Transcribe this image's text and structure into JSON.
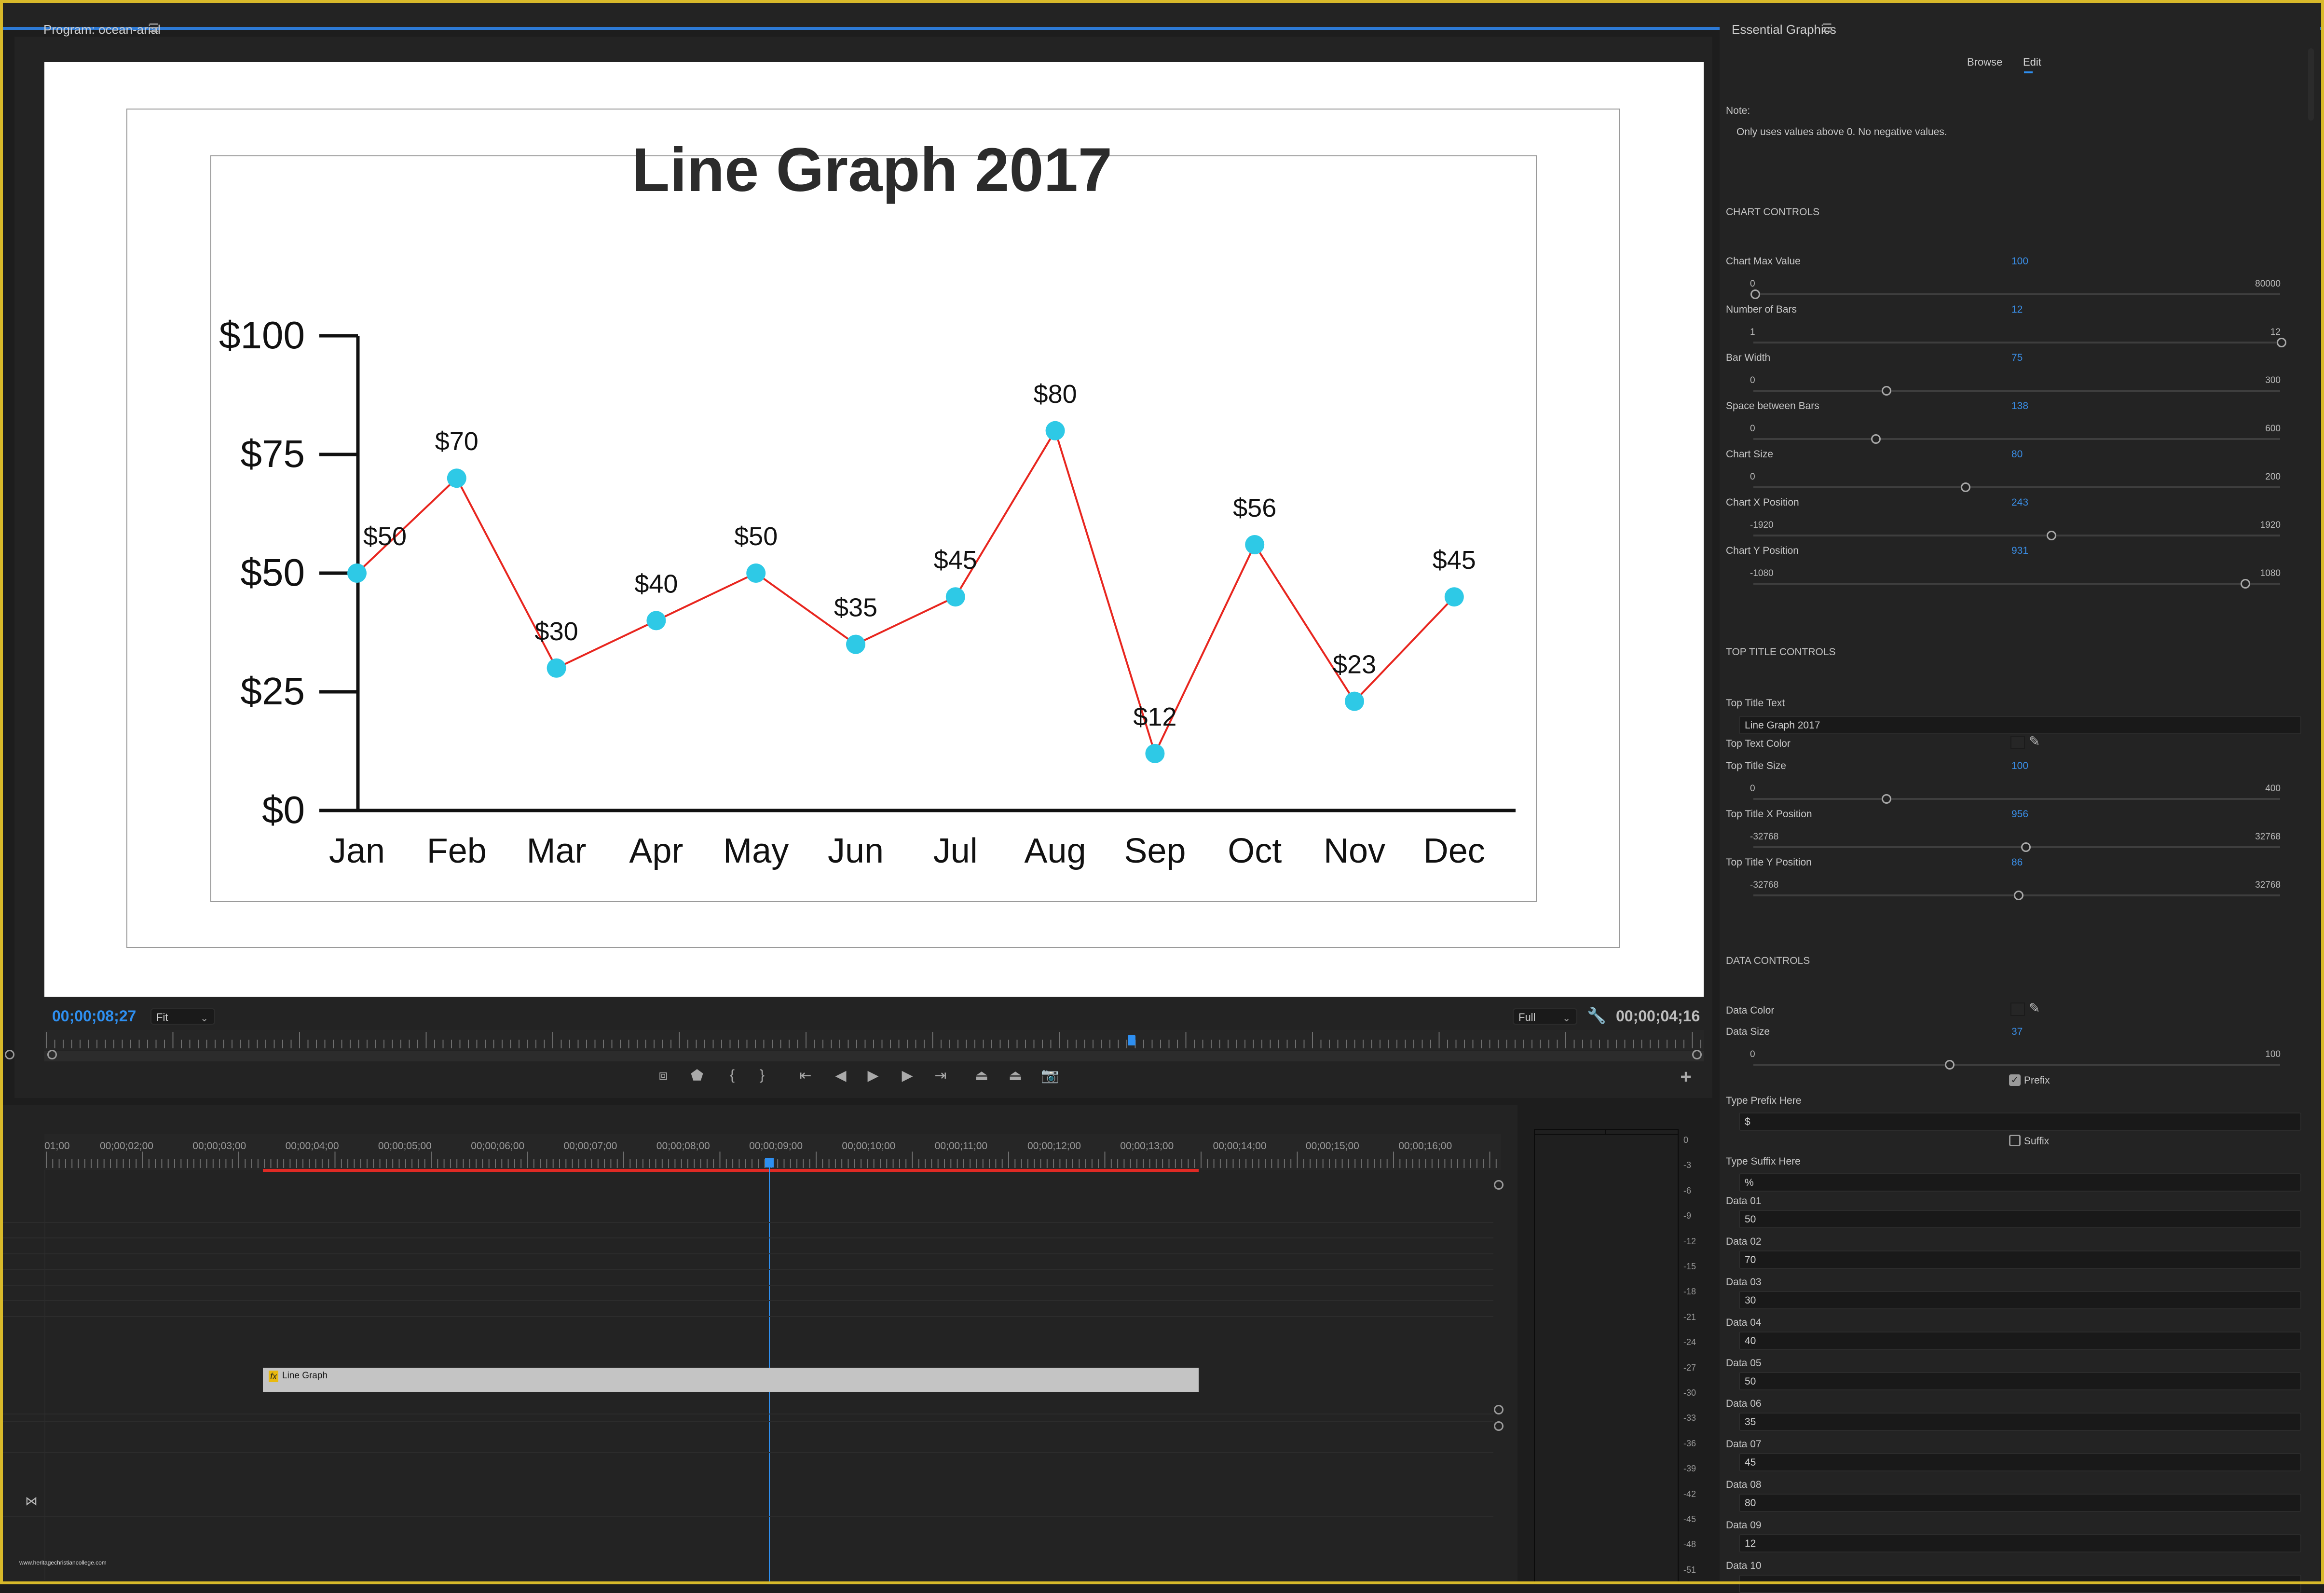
{
  "program_panel": {
    "title": "Program: ocean-arial",
    "menu_icon": "hamburger-menu-icon",
    "current_timecode": "00;00;08;27",
    "zoom_select": "Fit",
    "resolution_select": "Full",
    "duration_timecode": "00;00;04;16",
    "transport_icons": [
      "safe-margins-icon",
      "add-marker-icon",
      "mark-in-icon",
      "mark-out-icon",
      "go-to-in-icon",
      "step-back-icon",
      "play-icon",
      "step-forward-icon",
      "go-to-out-icon",
      "lift-icon",
      "extract-icon",
      "export-frame-icon"
    ],
    "add_button": "+"
  },
  "chart_data": {
    "type": "line",
    "title": "Line Graph 2017",
    "categories": [
      "Jan",
      "Feb",
      "Mar",
      "Apr",
      "May",
      "Jun",
      "Jul",
      "Aug",
      "Sep",
      "Oct",
      "Nov",
      "Dec"
    ],
    "series": [
      {
        "name": "Data",
        "values": [
          50,
          70,
          30,
          40,
          50,
          35,
          45,
          80,
          12,
          56,
          23,
          45
        ]
      }
    ],
    "data_labels": [
      "$50",
      "$70",
      "$30",
      "$40",
      "$50",
      "$35",
      "$45",
      "$80",
      "$12",
      "$56",
      "$23",
      "$45"
    ],
    "yticks": [
      0,
      25,
      50,
      75,
      100
    ],
    "ytick_labels": [
      "$0",
      "$25",
      "$50",
      "$75",
      "$100"
    ],
    "ylim": [
      0,
      100
    ],
    "xlabel": "",
    "ylabel": "",
    "grid": false,
    "line_color": "#e8261f",
    "point_color": "#2ec9e6",
    "axis_color": "#111111"
  },
  "timeline": {
    "ruler_labels": [
      "01;00",
      "00;00;02;00",
      "00;00;03;00",
      "00;00;04;00",
      "00;00;05;00",
      "00;00;06;00",
      "00;00;07;00",
      "00;00;08;00",
      "00;00;09;00",
      "00;00;10;00",
      "00;00;11;00",
      "00;00;12;00",
      "00;00;13;00",
      "00;00;14;00",
      "00;00;15;00",
      "00;00;16;00"
    ],
    "clip_name": "Line Graph",
    "clip_fx_badge": "fx",
    "watermark": "www.heritagechristiancollege.com",
    "meter_labels": [
      "0",
      "-3",
      "-6",
      "-9",
      "-12",
      "-15",
      "-18",
      "-21",
      "-24",
      "-27",
      "-30",
      "-33",
      "-36",
      "-39",
      "-42",
      "-45",
      "-48",
      "-51"
    ]
  },
  "essential_graphics": {
    "title": "Essential Graphics",
    "tabs": [
      "Browse",
      "Edit"
    ],
    "active_tab": "Edit",
    "note_label": "Note:",
    "note_text": "Only uses values above 0. No negative values.",
    "chart_controls": {
      "heading": "CHART CONTROLS",
      "sliders": [
        {
          "label": "Chart Max Value",
          "value": "100",
          "min": "0",
          "max": "80000"
        },
        {
          "label": "Number of Bars",
          "value": "12",
          "min": "1",
          "max": "12"
        },
        {
          "label": "Bar Width",
          "value": "75",
          "min": "0",
          "max": "300"
        },
        {
          "label": "Space between Bars",
          "value": "138",
          "min": "0",
          "max": "600"
        },
        {
          "label": "Chart Size",
          "value": "80",
          "min": "0",
          "max": "200"
        },
        {
          "label": "Chart X Position",
          "value": "243",
          "min": "-1920",
          "max": "1920"
        },
        {
          "label": "Chart Y Position",
          "value": "931",
          "min": "-1080",
          "max": "1080"
        }
      ]
    },
    "title_controls": {
      "heading": "TOP TITLE CONTROLS",
      "text_label": "Top Title Text",
      "text_value": "Line Graph 2017",
      "color_label": "Top Text Color",
      "sliders": [
        {
          "label": "Top Title Size",
          "value": "100",
          "min": "0",
          "max": "400"
        },
        {
          "label": "Top Title X Position",
          "value": "956",
          "min": "-32768",
          "max": "32768"
        },
        {
          "label": "Top Title Y Position",
          "value": "86",
          "min": "-32768",
          "max": "32768"
        }
      ]
    },
    "data_controls": {
      "heading": "DATA CONTROLS",
      "color_label": "Data Color",
      "size_slider": {
        "label": "Data Size",
        "value": "37",
        "min": "0",
        "max": "100"
      },
      "prefix_checkbox": {
        "label": "Prefix",
        "checked": true
      },
      "prefix_label": "Type Prefix Here",
      "prefix_value": "$",
      "suffix_checkbox": {
        "label": "Suffix",
        "checked": false
      },
      "suffix_label": "Type Suffix Here",
      "suffix_value": "%",
      "fields": [
        {
          "label": "Data 01",
          "value": "50"
        },
        {
          "label": "Data 02",
          "value": "70"
        },
        {
          "label": "Data 03",
          "value": "30"
        },
        {
          "label": "Data 04",
          "value": "40"
        },
        {
          "label": "Data 05",
          "value": "50"
        },
        {
          "label": "Data 06",
          "value": "35"
        },
        {
          "label": "Data 07",
          "value": "45"
        },
        {
          "label": "Data 08",
          "value": "80"
        },
        {
          "label": "Data 09",
          "value": "12"
        },
        {
          "label": "Data 10",
          "value": ""
        }
      ]
    }
  }
}
